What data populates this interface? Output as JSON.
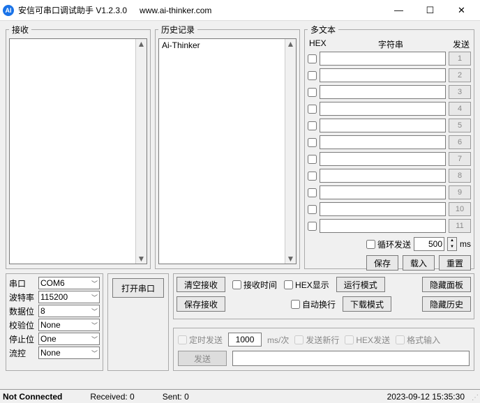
{
  "window": {
    "icon_text": "AI",
    "title": "安信可串口调试助手 V1.2.3.0",
    "url": "www.ai-thinker.com"
  },
  "panels": {
    "receive_label": "接收",
    "history_label": "历史记录",
    "history_content": "Ai-Thinker",
    "multi_label": "多文本",
    "multi_headers": {
      "hex": "HEX",
      "string": "字符串",
      "send": "发送"
    },
    "multi_rows": [
      {
        "checked": false,
        "value": "",
        "btn": "1"
      },
      {
        "checked": false,
        "value": "",
        "btn": "2"
      },
      {
        "checked": false,
        "value": "",
        "btn": "3"
      },
      {
        "checked": false,
        "value": "",
        "btn": "4"
      },
      {
        "checked": false,
        "value": "",
        "btn": "5"
      },
      {
        "checked": false,
        "value": "",
        "btn": "6"
      },
      {
        "checked": false,
        "value": "",
        "btn": "7"
      },
      {
        "checked": false,
        "value": "",
        "btn": "8"
      },
      {
        "checked": false,
        "value": "",
        "btn": "9"
      },
      {
        "checked": false,
        "value": "",
        "btn": "10"
      },
      {
        "checked": false,
        "value": "",
        "btn": "11"
      }
    ],
    "loop_send_label": "循环发送",
    "loop_interval": "500",
    "loop_unit": "ms",
    "save_btn": "保存",
    "load_btn": "载入",
    "reset_btn": "重置"
  },
  "port": {
    "labels": {
      "port": "串口",
      "baud": "波特率",
      "data": "数据位",
      "parity": "校验位",
      "stop": "停止位",
      "flow": "流控"
    },
    "values": {
      "port": "COM6",
      "baud": "115200",
      "data": "8",
      "parity": "None",
      "stop": "One",
      "flow": "None"
    },
    "open_btn": "打开串口"
  },
  "controls": {
    "clear_recv": "清空接收",
    "save_recv": "保存接收",
    "recv_time": "接收时间",
    "hex_display": "HEX显示",
    "auto_wrap": "自动换行",
    "run_mode": "运行模式",
    "download_mode": "下载模式",
    "hide_panel": "隐藏面板",
    "hide_history": "隐藏历史"
  },
  "timed": {
    "timed_send": "定时发送",
    "interval": "1000",
    "unit": "ms/次",
    "send_newline": "发送新行",
    "hex_send": "HEX发送",
    "format_input": "格式输入",
    "send_btn": "发送",
    "msg_value": ""
  },
  "status": {
    "conn": "Not Connected",
    "received_label": "Received: 0",
    "sent_label": "Sent: 0",
    "time": "2023-09-12 15:35:30"
  }
}
